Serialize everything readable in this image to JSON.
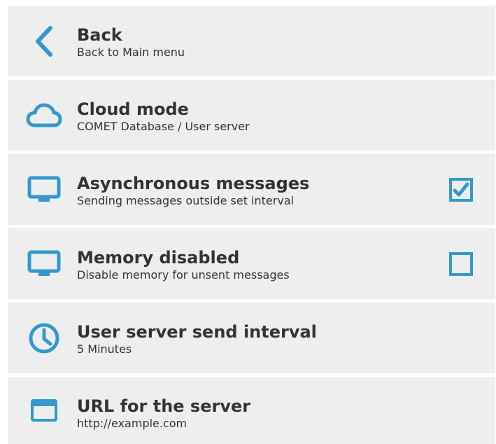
{
  "accent_color": "#3399cc",
  "menu": {
    "items": [
      {
        "icon": "chevron-left-icon",
        "title": "Back",
        "subtitle": "Back to Main menu"
      },
      {
        "icon": "cloud-icon",
        "title": "Cloud mode",
        "subtitle": "COMET Database / User server"
      },
      {
        "icon": "monitor-icon",
        "title": "Asynchronous messages",
        "subtitle": "Sending messages outside set interval",
        "checked": true
      },
      {
        "icon": "monitor-icon",
        "title": "Memory disabled",
        "subtitle": "Disable memory for unsent messages",
        "checked": false
      },
      {
        "icon": "clock-icon",
        "title": "User server send interval",
        "subtitle": "5 Minutes"
      },
      {
        "icon": "window-icon",
        "title": "URL for the server",
        "subtitle": "http://example.com"
      }
    ]
  }
}
